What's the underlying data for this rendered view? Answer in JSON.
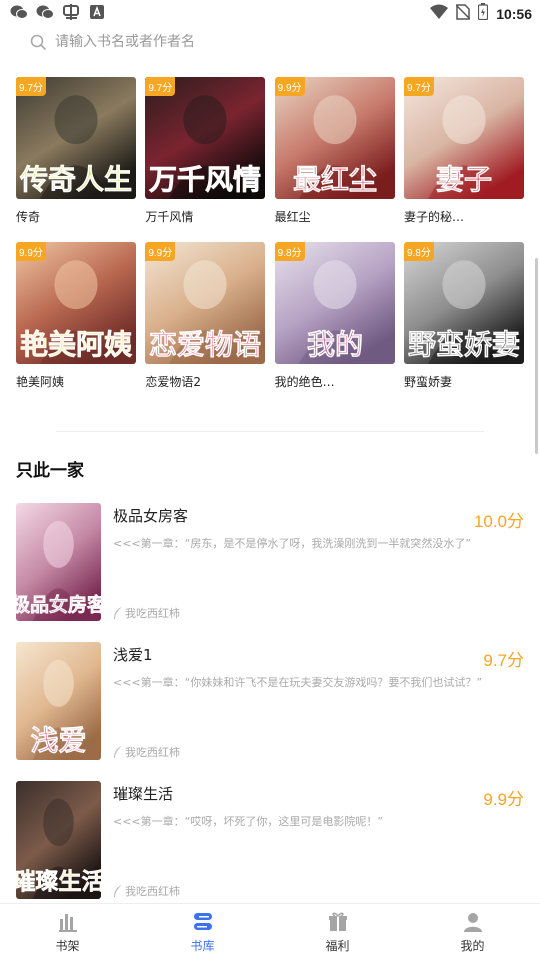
{
  "status_bar": {
    "time": "10:56",
    "left_icons": [
      "wechat-icon",
      "wechat-icon",
      "app-notification-icon",
      "a-notification-icon"
    ],
    "right_icons": [
      "wifi-icon",
      "no-sim-icon",
      "battery-icon"
    ]
  },
  "search": {
    "placeholder": "请输入书名或者作者名"
  },
  "grid": [
    [
      {
        "title": "传奇",
        "score": "9.7分",
        "cover_text": "传奇人生",
        "colors": [
          "#3d3a33",
          "#8a7a5e",
          "#1c1a16"
        ],
        "text_color": "#d8e86b"
      },
      {
        "title": "万千风情",
        "score": "9.7分",
        "cover_text": "万千风情",
        "colors": [
          "#2a1d1d",
          "#7b2430",
          "#0f0a0a"
        ],
        "text_color": "#ffffff"
      },
      {
        "title": "最红尘",
        "score": "9.9分",
        "cover_text": "最红尘",
        "colors": [
          "#e9d5c4",
          "#c77a6b",
          "#7a1d1d"
        ],
        "text_color": "#c0182c"
      },
      {
        "title": "妻子的秘…",
        "score": "9.7分",
        "cover_text": "妻子",
        "colors": [
          "#f4e7df",
          "#d9b5a3",
          "#a01b22"
        ],
        "text_color": "#b0101e"
      }
    ],
    [
      {
        "title": "艳美阿姨",
        "score": "9.9分",
        "cover_text": "艳美阿姨",
        "colors": [
          "#f0c7a4",
          "#b8674f",
          "#6e2b28"
        ],
        "text_color": "#ffe25a"
      },
      {
        "title": "恋爱物语2",
        "score": "9.9分",
        "cover_text": "恋爱物语",
        "colors": [
          "#f3e6d5",
          "#d9b08b",
          "#9b6a4a"
        ],
        "text_color": "#e4325e"
      },
      {
        "title": "我的绝色…",
        "score": "9.8分",
        "cover_text": "我的",
        "colors": [
          "#e8e2ec",
          "#b7a3c4",
          "#6f5a82"
        ],
        "text_color": "#c2186b"
      },
      {
        "title": "野蛮娇妻",
        "score": "9.8分",
        "cover_text": "野蛮娇妻",
        "colors": [
          "#d7d7d7",
          "#8e8e8e",
          "#1b1b1b"
        ],
        "text_color": "#111111"
      }
    ]
  ],
  "section_title": "只此一家",
  "list": [
    {
      "title": "极品女房客",
      "score": "10.0分",
      "desc": "<<<第一章：“房东，是不是停水了呀，我洗澡刚洗到一半就突然没水了”",
      "author": "我吃西红柿",
      "cover_text": "极品女房客",
      "colors": [
        "#f4d9e6",
        "#c58aa6",
        "#7a2a52"
      ],
      "text_color": "#8a1a58"
    },
    {
      "title": "浅爱1",
      "score": "9.7分",
      "desc": "<<<第一章：“你妹妹和许飞不是在玩夫妻交友游戏吗？要不我们也试试？”",
      "author": "我吃西红柿",
      "cover_text": "浅爱",
      "colors": [
        "#f6e6cf",
        "#e0b890",
        "#9c6b48"
      ],
      "text_color": "#e0307a"
    },
    {
      "title": "璀璨生活",
      "score": "9.9分",
      "desc": "<<<第一章：“哎呀，坏死了你，这里可是电影院呢！”",
      "author": "我吃西红柿",
      "cover_text": "璀璨生活",
      "colors": [
        "#3a2f2c",
        "#7d5b4a",
        "#1b1413"
      ],
      "text_color": "#f0c85a"
    }
  ],
  "nav": [
    {
      "label": "书架",
      "icon": "bookshelf-icon",
      "active": false
    },
    {
      "label": "书库",
      "icon": "library-icon",
      "active": true
    },
    {
      "label": "福利",
      "icon": "gift-icon",
      "active": false
    },
    {
      "label": "我的",
      "icon": "user-icon",
      "active": false
    }
  ],
  "colors": {
    "accent": "#3a72f0",
    "score": "#f5a623",
    "badge": "#f5a623"
  }
}
